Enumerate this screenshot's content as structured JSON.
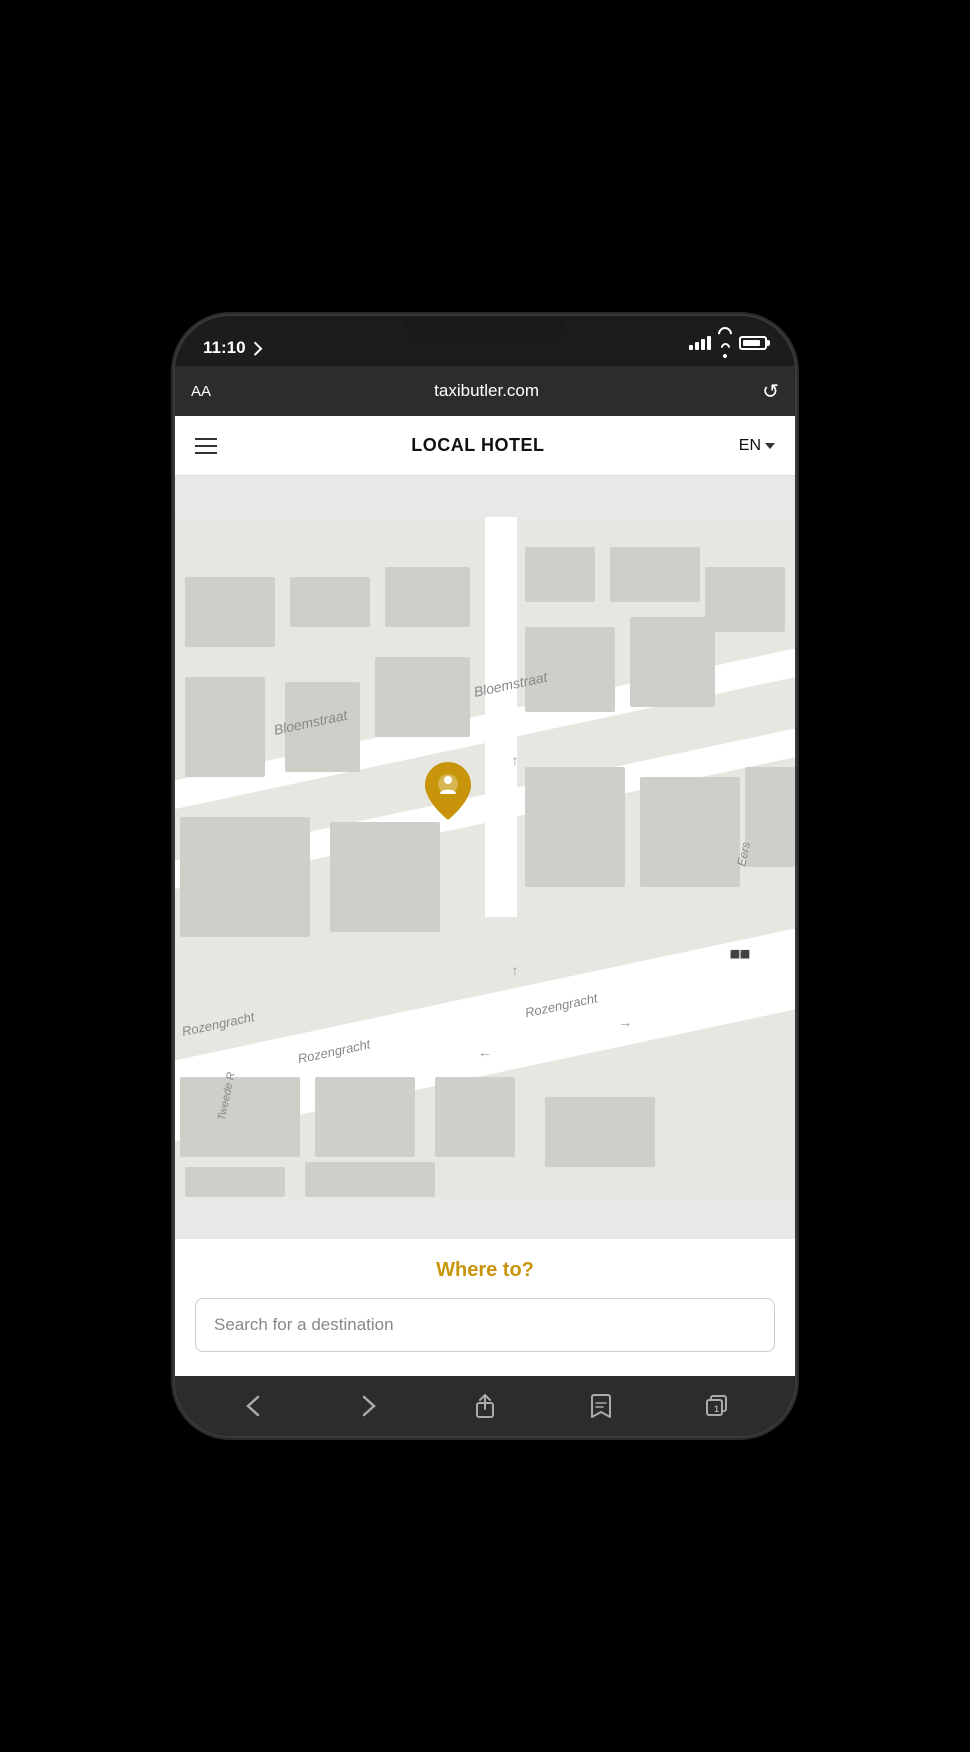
{
  "phone": {
    "status_bar": {
      "time": "11:10",
      "url": "taxibutler.com"
    },
    "browser": {
      "aa_label": "AA",
      "url": "taxibutler.com",
      "refresh_symbol": "↺"
    },
    "nav": {
      "title": "LOCAL HOTEL",
      "lang": "EN"
    },
    "map": {
      "street_labels": [
        "Bloemstraat",
        "Bloemstraat",
        "Rozengracht",
        "Rozengracht",
        "Rozengracht",
        "Tweede R"
      ]
    },
    "bottom_panel": {
      "where_to_label": "Where to?",
      "search_placeholder": "Search for a destination"
    },
    "bottom_nav": {
      "back_label": "‹",
      "forward_label": "›"
    }
  }
}
